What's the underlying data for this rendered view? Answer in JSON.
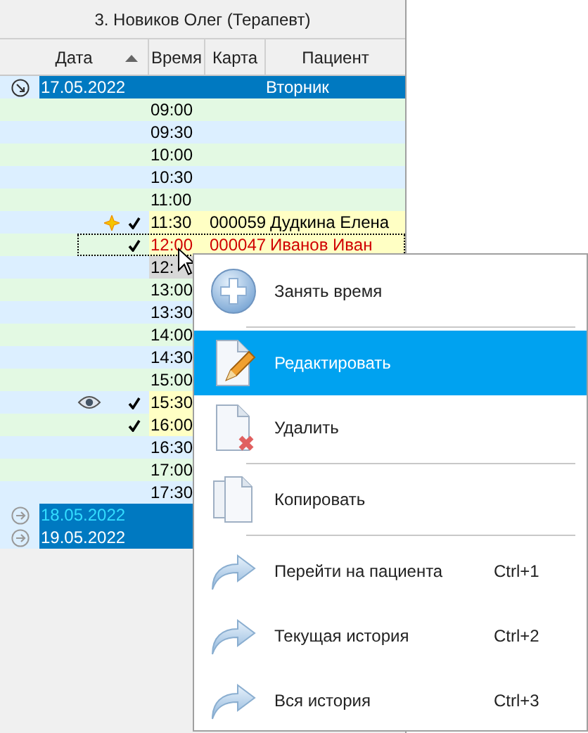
{
  "grid": {
    "title": "3. Новиков Олег (Терапевт)",
    "columns": [
      {
        "label": "Дата",
        "sorted": true
      },
      {
        "label": "Время",
        "sorted": false
      },
      {
        "label": "Карта",
        "sorted": false
      },
      {
        "label": "Пациент",
        "sorted": false
      }
    ],
    "rows": [
      {
        "kind": "date",
        "date": "17.05.2022",
        "weekday": "Вторник",
        "expanded": true,
        "highlighted": false
      },
      {
        "kind": "slot",
        "time": "09:00",
        "checked": false,
        "flagged": false,
        "viewed": false,
        "focused": false,
        "hovered": false
      },
      {
        "kind": "slot",
        "time": "09:30",
        "checked": false,
        "flagged": false,
        "viewed": false,
        "focused": false,
        "hovered": false
      },
      {
        "kind": "slot",
        "time": "10:00",
        "checked": false,
        "flagged": false,
        "viewed": false,
        "focused": false,
        "hovered": false
      },
      {
        "kind": "slot",
        "time": "10:30",
        "checked": false,
        "flagged": false,
        "viewed": false,
        "focused": false,
        "hovered": false
      },
      {
        "kind": "slot",
        "time": "11:00",
        "checked": false,
        "flagged": false,
        "viewed": false,
        "focused": false,
        "hovered": false
      },
      {
        "kind": "slot",
        "time": "11:30",
        "card": "000059",
        "patient": "Дудкина Елена",
        "checked": true,
        "flagged": true,
        "viewed": false,
        "focused": false,
        "hovered": false
      },
      {
        "kind": "slot",
        "time": "12:00",
        "card": "000047",
        "patient": "Иванов Иван",
        "checked": true,
        "flagged": false,
        "viewed": false,
        "focused": true,
        "hovered": false
      },
      {
        "kind": "slot",
        "time": "12:",
        "checked": false,
        "flagged": false,
        "viewed": false,
        "focused": false,
        "hovered": true
      },
      {
        "kind": "slot",
        "time": "13:00",
        "checked": false,
        "flagged": false,
        "viewed": false,
        "focused": false,
        "hovered": false
      },
      {
        "kind": "slot",
        "time": "13:30",
        "checked": false,
        "flagged": false,
        "viewed": false,
        "focused": false,
        "hovered": false
      },
      {
        "kind": "slot",
        "time": "14:00",
        "checked": false,
        "flagged": false,
        "viewed": false,
        "focused": false,
        "hovered": false
      },
      {
        "kind": "slot",
        "time": "14:30",
        "checked": false,
        "flagged": false,
        "viewed": false,
        "focused": false,
        "hovered": false
      },
      {
        "kind": "slot",
        "time": "15:00",
        "checked": false,
        "flagged": false,
        "viewed": false,
        "focused": false,
        "hovered": false
      },
      {
        "kind": "slot",
        "time": "15:30",
        "checked": true,
        "flagged": false,
        "viewed": true,
        "focused": false,
        "hovered": false
      },
      {
        "kind": "slot",
        "time": "16:00",
        "checked": true,
        "flagged": false,
        "viewed": false,
        "focused": false,
        "hovered": false
      },
      {
        "kind": "slot",
        "time": "16:30",
        "checked": false,
        "flagged": false,
        "viewed": false,
        "focused": false,
        "hovered": false
      },
      {
        "kind": "slot",
        "time": "17:00",
        "checked": false,
        "flagged": false,
        "viewed": false,
        "focused": false,
        "hovered": false
      },
      {
        "kind": "slot",
        "time": "17:30",
        "checked": false,
        "flagged": false,
        "viewed": false,
        "focused": false,
        "hovered": false
      },
      {
        "kind": "date",
        "date": "18.05.2022",
        "expanded": false,
        "highlighted": true
      },
      {
        "kind": "date",
        "date": "19.05.2022",
        "expanded": false,
        "highlighted": false
      }
    ]
  },
  "menu": [
    {
      "label": "Занять время",
      "selected": false,
      "separator_after": true
    },
    {
      "label": "Редактировать",
      "selected": true,
      "separator_after": false
    },
    {
      "label": "Удалить",
      "selected": false,
      "separator_after": true
    },
    {
      "label": "Копировать",
      "selected": false,
      "separator_after": true
    },
    {
      "label": "Перейти на пациента",
      "shortcut": "Ctrl+1",
      "selected": false,
      "separator_after": false
    },
    {
      "label": "Текущая история",
      "shortcut": "Ctrl+2",
      "selected": false,
      "separator_after": false
    },
    {
      "label": "Вся история",
      "shortcut": "Ctrl+3",
      "selected": false,
      "separator_after": false
    }
  ]
}
